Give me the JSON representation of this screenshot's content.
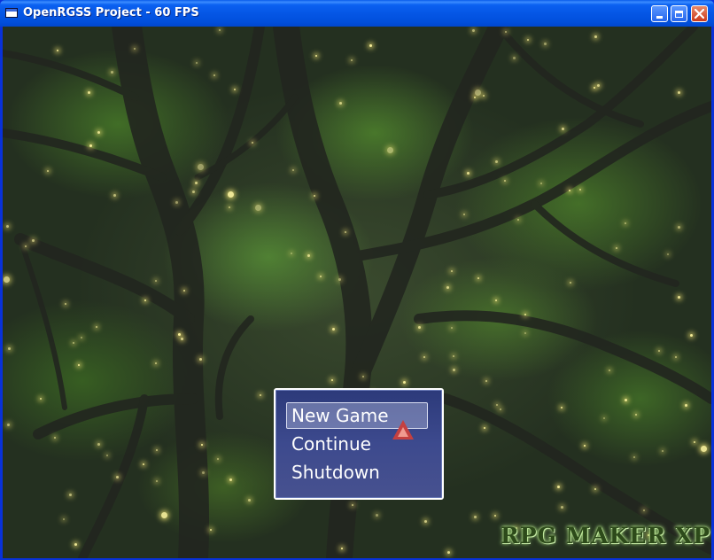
{
  "window": {
    "title": "OpenRGSS Project - 60 FPS"
  },
  "menu": {
    "items": [
      "New Game",
      "Continue",
      "Shutdown"
    ],
    "selected_index": 0
  },
  "logo": {
    "text": "RPG MAKER XP"
  },
  "colors": {
    "menu_background": "#3d4a8e",
    "selection_arrow": "#c44040",
    "firefly": "#fff6a0"
  }
}
